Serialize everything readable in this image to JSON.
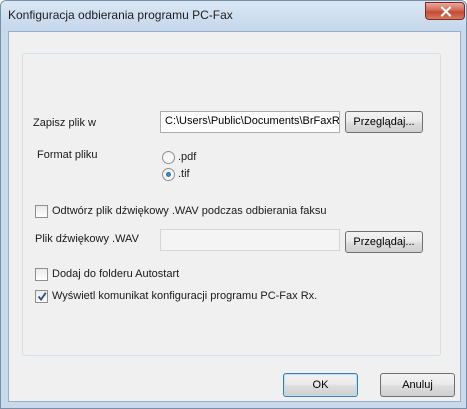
{
  "window": {
    "title": "Konfiguracja odbierania programu PC-Fax",
    "close_icon": "close-icon"
  },
  "save_location": {
    "label": "Zapisz plik w",
    "path_value": "C:\\Users\\Public\\Documents\\BrFaxR",
    "browse_label": "Przeglądaj..."
  },
  "file_format": {
    "label": "Format pliku",
    "options": [
      {
        "label": ".pdf",
        "selected": false
      },
      {
        "label": ".tif",
        "selected": true
      }
    ]
  },
  "play_wav": {
    "label": "Odtwórz plik dźwiękowy .WAV podczas odbierania faksu",
    "checked": false
  },
  "wav_file": {
    "label": "Plik dźwiękowy .WAV",
    "value": "",
    "browse_label": "Przeglądaj..."
  },
  "autostart": {
    "label": "Dodaj do folderu Autostart",
    "checked": false
  },
  "show_message": {
    "label": "Wyświetl komunikat konfiguracji programu PC-Fax Rx.",
    "checked": true
  },
  "buttons": {
    "ok_label": "OK",
    "cancel_label": "Anuluj"
  },
  "colors": {
    "titlebar": "#c5d7ec",
    "close_button": "#c44a35",
    "dialog_background": "#f0f0f0"
  }
}
